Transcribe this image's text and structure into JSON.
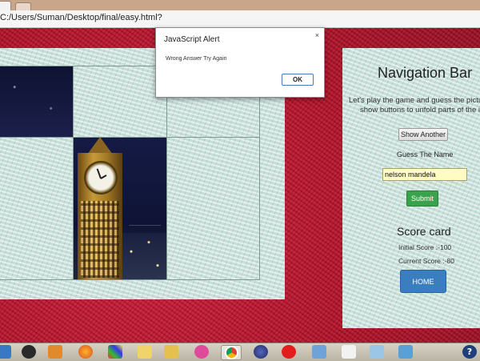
{
  "browser": {
    "url": "C:/Users/Suman/Desktop/final/easy.html?"
  },
  "alert": {
    "title": "JavaScript Alert",
    "message": "Wrong Answer Try Again",
    "ok_label": "OK",
    "close_symbol": "×"
  },
  "nav": {
    "title": "Navigation Bar",
    "instructions_line1": "Let's play the game and guess the picture Cli",
    "instructions_line2": "show buttons to unfold parts of the imag",
    "show_another_label": "Show Another",
    "guess_label": "Guess The Name",
    "name_value": "nelson mandela",
    "submit_label": "Submit",
    "score_title": "Score card",
    "initial_score": "Initial Score :-100",
    "current_score": "Current Score :-80",
    "home_label": "HOME"
  },
  "taskbar": {
    "icons": [
      "monitor-icon",
      "webcam-icon",
      "media-player-icon",
      "firefox-icon",
      "app-grid-icon",
      "folder-icon",
      "file-manager-icon",
      "messenger-icon",
      "chrome-icon",
      "network-icon",
      "vodafone-icon",
      "box-icon",
      "writer-icon",
      "viewer-icon",
      "image-viewer-icon",
      "help-icon"
    ],
    "help_symbol": "?"
  }
}
